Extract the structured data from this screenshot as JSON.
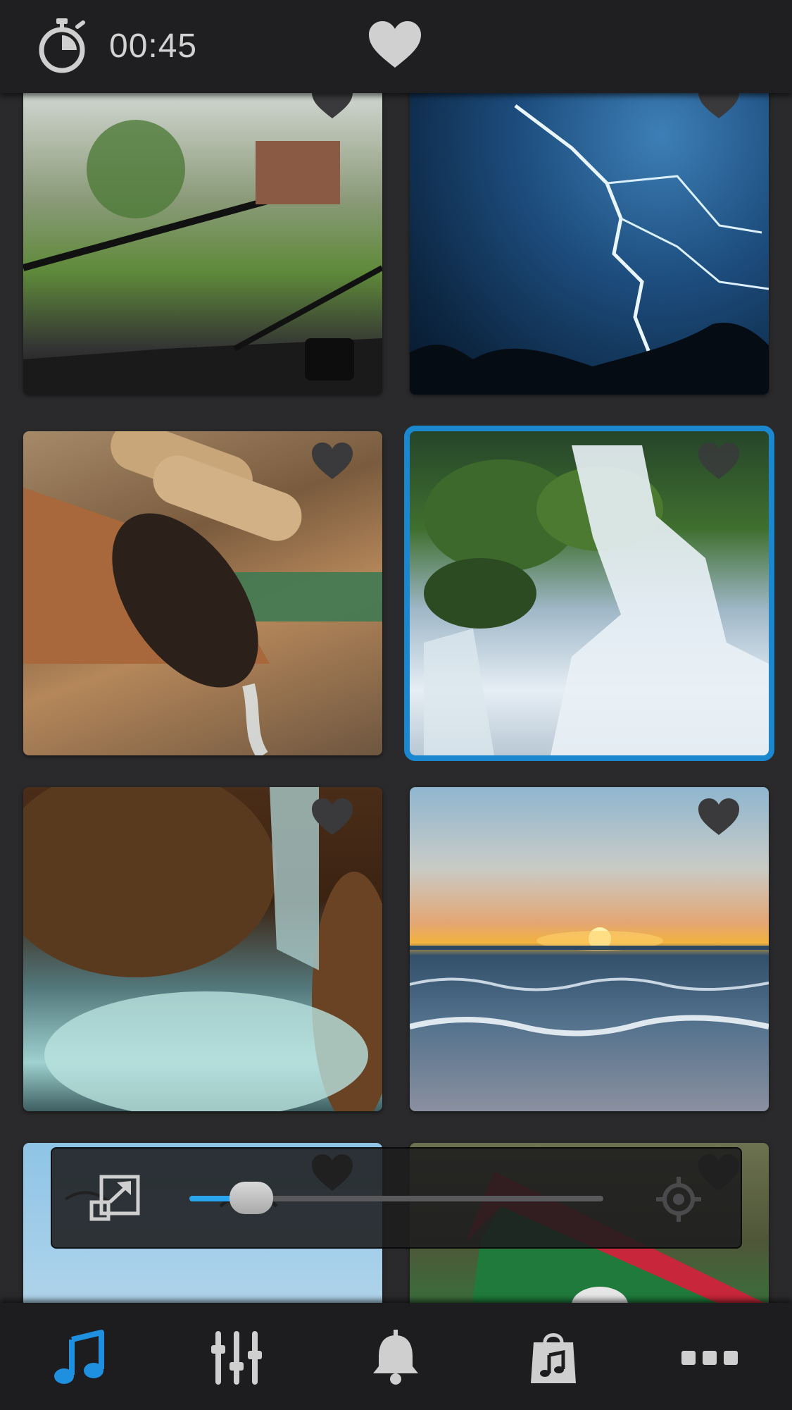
{
  "timer": {
    "time": "00:45"
  },
  "tiles": [
    {
      "name": "tile-rain-windshield",
      "favorite": false
    },
    {
      "name": "tile-lightning-storm",
      "favorite": false
    },
    {
      "name": "tile-bamboo-fountain",
      "favorite": false
    },
    {
      "name": "tile-waterfall",
      "favorite": false,
      "selected": true
    },
    {
      "name": "tile-stream-rocks",
      "favorite": false
    },
    {
      "name": "tile-ocean-sunset",
      "favorite": false
    },
    {
      "name": "tile-seagull",
      "favorite": false
    },
    {
      "name": "tile-boat",
      "favorite": false
    }
  ],
  "player": {
    "volume_percent": 15
  },
  "icons": {
    "timer": "stopwatch-icon",
    "favorites": "heart-icon",
    "expand": "expand-icon",
    "locate": "crosshair-icon",
    "nav": [
      "music-note-icon",
      "equalizer-icon",
      "bell-icon",
      "music-bag-icon",
      "more-icon"
    ]
  },
  "colors": {
    "accent": "#1b87cf",
    "slider_fill": "#2aa4ec",
    "icon_gray": "#cfcfcf",
    "heart_dark": "#3a3a3c"
  }
}
